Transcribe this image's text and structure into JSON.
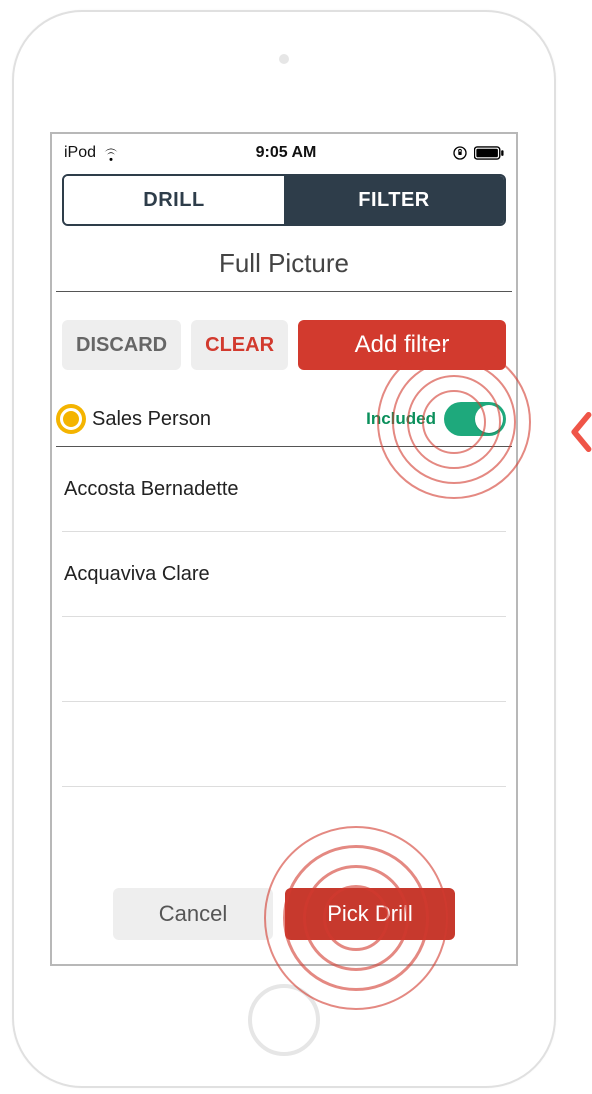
{
  "status_bar": {
    "device": "iPod",
    "time": "9:05 AM"
  },
  "tabs": {
    "drill": "DRILL",
    "filter": "FILTER",
    "active": "filter"
  },
  "page_title": "Full Picture",
  "actions": {
    "discard": "DISCARD",
    "clear": "CLEAR",
    "add_filter": "Add filter"
  },
  "category": {
    "label": "Sales Person",
    "included_label": "Included",
    "included_state": true
  },
  "list_items": [
    {
      "name": "Accosta Bernadette"
    },
    {
      "name": "Acquaviva Clare"
    },
    {
      "name": ""
    },
    {
      "name": ""
    }
  ],
  "footer": {
    "cancel": "Cancel",
    "pick_drill": "Pick Drill"
  }
}
